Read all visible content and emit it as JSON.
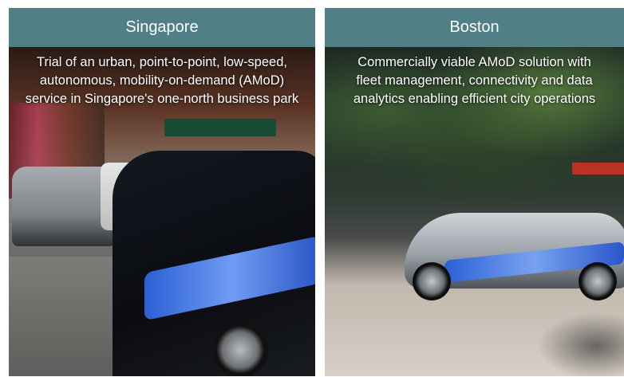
{
  "panels": {
    "singapore": {
      "title": "Singapore",
      "caption_lines": [
        "Trial of an urban, point-to-point, low-speed,",
        "autonomous, mobility-on-demand (AMoD)",
        "service in Singapore's one-north business park"
      ]
    },
    "boston": {
      "title": "Boston",
      "caption_lines": [
        "Commercially viable AMoD solution with",
        "fleet management, connectivity and data",
        "analytics enabling efficient city operations"
      ]
    }
  },
  "colors": {
    "header_bg": "#507f86",
    "header_text": "#ffffff",
    "caption_text": "#ffffff"
  }
}
